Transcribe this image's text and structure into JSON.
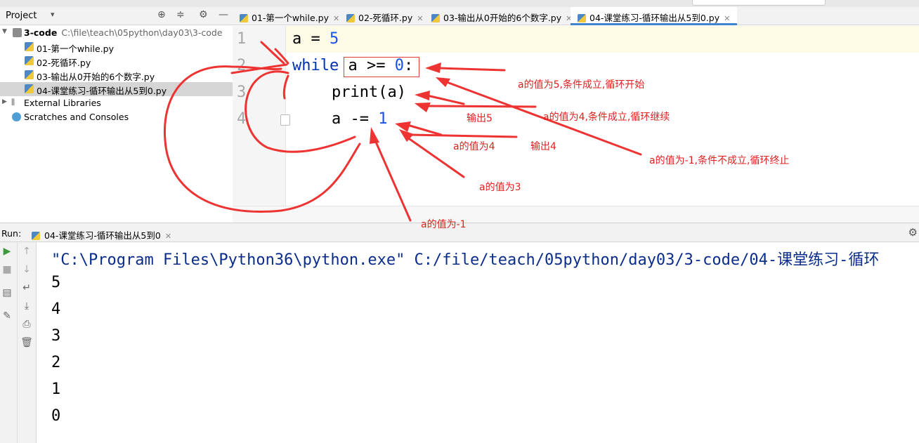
{
  "project_panel": {
    "title": "Project",
    "tree": [
      {
        "label": "3-code",
        "path": "C:\\file\\teach\\05python\\day03\\3-code"
      },
      {
        "label": "01-第一个while.py"
      },
      {
        "label": "02-死循环.py"
      },
      {
        "label": "03-输出从0开始的6个数字.py"
      },
      {
        "label": "04-课堂练习-循环输出从5到0.py"
      },
      {
        "label": "External Libraries"
      },
      {
        "label": "Scratches and Consoles"
      }
    ]
  },
  "tabs": [
    {
      "label": "01-第一个while.py"
    },
    {
      "label": "02-死循环.py"
    },
    {
      "label": "03-输出从0开始的6个数字.py"
    },
    {
      "label": "04-课堂练习-循环输出从5到0.py"
    }
  ],
  "editor": {
    "line_numbers": [
      "1",
      "2",
      "3",
      "4"
    ],
    "code": {
      "l1_var": "a = ",
      "l1_num": "5",
      "l2_kw": "while",
      "l2_cond": " a >= ",
      "l2_num": "0",
      "l2_colon": ":",
      "l3": "print(a)",
      "l4_op": "a -= ",
      "l4_num": "1"
    }
  },
  "run_panel": {
    "label": "Run:",
    "tab": "04-课堂练习-循环输出从5到0",
    "command": "\"C:\\Program Files\\Python36\\python.exe\" C:/file/teach/05python/day03/3-code/04-课堂练习-循环",
    "output": [
      "5",
      "4",
      "3",
      "2",
      "1",
      "0"
    ]
  },
  "annotations": [
    {
      "text": "a的值为5,条件成立,循环开始"
    },
    {
      "text": "a的值为4,条件成立,循环继续"
    },
    {
      "text": "输出5"
    },
    {
      "text": "输出4"
    },
    {
      "text": "a的值为4"
    },
    {
      "text": "a的值为-1,条件不成立,循环终止"
    },
    {
      "text": "a的值为3"
    },
    {
      "text": "a的值为-1"
    }
  ],
  "colors": {
    "annotation": "#e02020",
    "keyword": "#0033b3",
    "number": "#1750eb",
    "selection": "#d5d5d5",
    "tab_underline": "#4083c9"
  }
}
